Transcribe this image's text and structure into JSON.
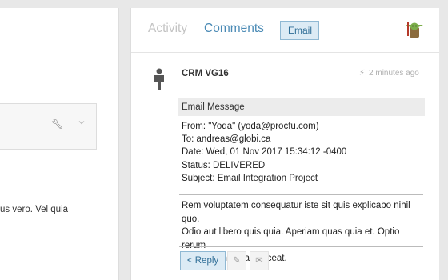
{
  "left": {
    "text": "us vero. Vel quia",
    "wrench_icon": "wrench-icon",
    "chevron_icon": "chevron-down-icon"
  },
  "tabs": {
    "activity": "Activity",
    "comments": "Comments",
    "email": "Email"
  },
  "entry": {
    "title": "CRM VG16",
    "time": "2 minutes ago",
    "message_header": "Email Message",
    "from": "From: \"Yoda\" (yoda@procfu.com)",
    "to": "To: andreas@globi.ca",
    "date": "Date: Wed, 01 Nov 2017 15:34:12 -0400",
    "status": "Status: DELIVERED",
    "subject": "Subject: Email Integration Project",
    "body_lines": [
      "Rem voluptatem consequatur iste sit quis explicabo nihil quo.",
      "Odio aut libero quis quia. Aperiam quas quia et. Optio rerum",
      "et sed eum fugiat placeat."
    ]
  },
  "actions": {
    "reply": "< Reply",
    "edit_icon": "pencil-icon",
    "mail_icon": "envelope-icon"
  },
  "colors": {
    "accent": "#4a8ab5",
    "button_bg": "#dcebf5",
    "button_border": "#8fb8d3"
  }
}
